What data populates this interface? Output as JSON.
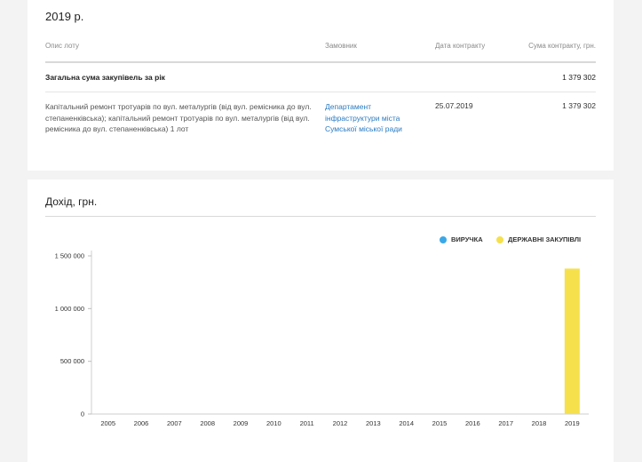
{
  "section": {
    "year_title": "2019 р.",
    "columns": {
      "lot": "Опис лоту",
      "customer": "Замовник",
      "date": "Дата контракту",
      "sum": "Сума контракту, грн."
    },
    "total": {
      "label": "Загальна сума закупівель за рік",
      "value": "1 379 302"
    },
    "rows": [
      {
        "description": "Капітальний ремонт тротуарів по вул. металургів (від вул. ремісника до вул. степаненківська); капітальний ремонт тротуарів по вул. металургів (від вул. ремісника до вул. степаненківська) 1 лот",
        "customer": "Департамент інфраструктури міста Сумської міської ради",
        "date": "25.07.2019",
        "sum": "1 379 302"
      }
    ]
  },
  "income": {
    "title": "Дохід, грн."
  },
  "chart_data": {
    "type": "bar",
    "categories": [
      "2005",
      "2006",
      "2007",
      "2008",
      "2009",
      "2010",
      "2011",
      "2012",
      "2013",
      "2014",
      "2015",
      "2016",
      "2017",
      "2018",
      "2019"
    ],
    "series": [
      {
        "name": "ВИРУЧКА",
        "color": "#3aa8e8",
        "values": [
          0,
          0,
          0,
          0,
          0,
          0,
          0,
          0,
          0,
          0,
          0,
          0,
          0,
          0,
          0
        ]
      },
      {
        "name": "ДЕРЖАВНІ ЗАКУПІВЛІ",
        "color": "#f6e04c",
        "values": [
          0,
          0,
          0,
          0,
          0,
          0,
          0,
          0,
          0,
          0,
          0,
          0,
          0,
          0,
          1379302
        ]
      }
    ],
    "y_ticks": [
      0,
      500000,
      1000000,
      1500000
    ],
    "y_tick_labels": [
      "0",
      "500 000",
      "1 000 000",
      "1 500 000"
    ],
    "ylim": [
      0,
      1500000
    ],
    "legend_position": "top-right",
    "grid": false
  }
}
